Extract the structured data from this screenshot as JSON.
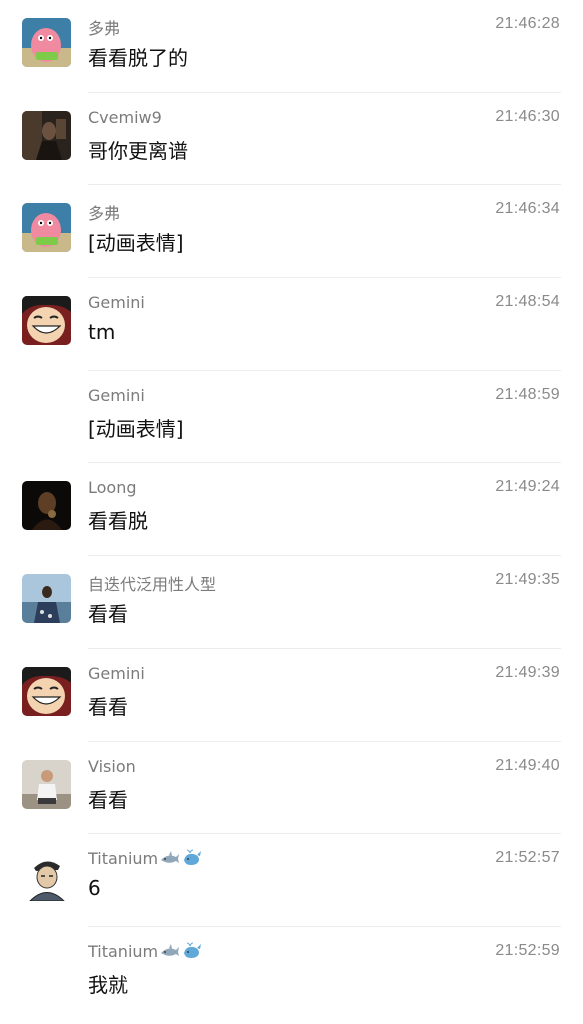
{
  "messages": [
    {
      "sender": "多弗",
      "time": "21:46:28",
      "text": "看看脱了的",
      "avatar": "patrick-avatar"
    },
    {
      "sender": "Cvemiw9",
      "time": "21:46:30",
      "text": "哥你更离谱",
      "avatar": "dark-photo-avatar"
    },
    {
      "sender": "多弗",
      "time": "21:46:34",
      "text": "[动画表情]",
      "avatar": "patrick-avatar"
    },
    {
      "sender": "Gemini",
      "time": "21:48:54",
      "text": "tm",
      "avatar": "luffy-avatar"
    },
    {
      "sender": "Gemini",
      "time": "21:48:59",
      "text": "[动画表情]",
      "avatar": ""
    },
    {
      "sender": "Loong",
      "time": "21:49:24",
      "text": "看看脱",
      "avatar": "night-selfie-avatar"
    },
    {
      "sender": "自迭代泛用性人型",
      "time": "21:49:35",
      "text": "看看",
      "avatar": "seaside-photo-avatar"
    },
    {
      "sender": "Gemini",
      "time": "21:49:39",
      "text": "看看",
      "avatar": "luffy-avatar"
    },
    {
      "sender": "Vision",
      "time": "21:49:40",
      "text": "看看",
      "avatar": "man-sitting-avatar"
    },
    {
      "sender": "Titanium",
      "time": "21:52:57",
      "text": "6",
      "avatar": "bandana-cartoon-avatar",
      "sender_emojis": [
        "shark-icon",
        "whale-icon"
      ]
    },
    {
      "sender": "Titanium",
      "time": "21:52:59",
      "text": "我就",
      "avatar": "",
      "sender_emojis": [
        "shark-icon",
        "whale-icon"
      ]
    }
  ],
  "colors": {
    "sender": "#7b7b7b",
    "time": "#8a8a8a",
    "text": "#111111",
    "divider": "#ececec"
  }
}
